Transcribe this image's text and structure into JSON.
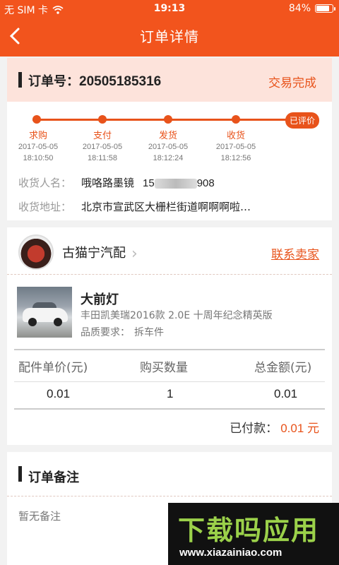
{
  "status_bar": {
    "carrier": "无 SIM 卡",
    "time": "19:13",
    "battery": "84%",
    "battery_level": 0.84
  },
  "nav": {
    "title": "订单详情"
  },
  "order": {
    "label": "订单号：",
    "number": "20505185316",
    "status": "交易完成",
    "progress": [
      {
        "name": "求购",
        "date": "2017-05-05",
        "time": "18:10:50"
      },
      {
        "name": "支付",
        "date": "2017-05-05",
        "time": "18:11:58"
      },
      {
        "name": "发货",
        "date": "2017-05-05",
        "time": "18:12:24"
      },
      {
        "name": "收货",
        "date": "2017-05-05",
        "time": "18:12:56"
      }
    ],
    "badge": "已评价",
    "receiver_label": "收货人名：",
    "receiver_name": "哦咯路墨镜",
    "receiver_phone_prefix": "15",
    "receiver_phone_suffix": "908",
    "address_label": "收货地址：",
    "address": "北京市宣武区大栅栏街道啊啊啊啦…"
  },
  "store": {
    "name": "古猫宁汽配",
    "contact": "联系卖家"
  },
  "product": {
    "title": "大前灯",
    "desc": "丰田凯美瑞2016款 2.0E 十周年纪念精英版",
    "quality_label": "品质要求：",
    "quality_value": "拆车件"
  },
  "table": {
    "headers": [
      "配件单价(元)",
      "购买数量",
      "总金额(元)"
    ],
    "values": [
      "0.01",
      "1",
      "0.01"
    ]
  },
  "paid": {
    "label": "已付款：",
    "amount": "0.01 元"
  },
  "remark": {
    "title": "订单备注",
    "body": "暂无备注"
  },
  "watermark": {
    "title": "下载吗应用",
    "url": "www.xiazainiao.com"
  }
}
